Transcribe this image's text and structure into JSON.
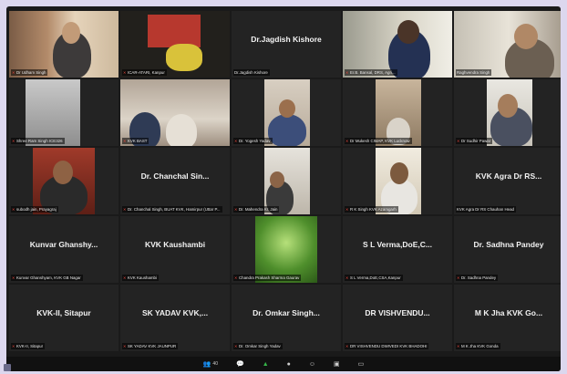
{
  "meeting": {
    "tiles": [
      {
        "caption": "Dr Udham Singh",
        "active": true,
        "video": true
      },
      {
        "caption": "ICAR-ATARI, Kanpur",
        "video": true
      },
      {
        "big": "Dr.Jagdish Kishore",
        "caption": "Dr.Jagdish Kishore"
      },
      {
        "caption": "Er.B. Bansal, DRS, Agri...",
        "video": true
      },
      {
        "caption": "Raghvendra Singh",
        "video": true
      },
      {
        "caption": "Shree Ram Singh ICE326",
        "video": true
      },
      {
        "caption": "KVK BAST",
        "video": true
      },
      {
        "caption": "Dr. Yogesh Yadav",
        "video": true
      },
      {
        "caption": "Dr Mukesh CIMAP, KVK Lucknow",
        "video": true
      },
      {
        "caption": "Dr Sudhir Pawar",
        "video": true
      },
      {
        "caption": "subodh jain, Prayagraj",
        "video": true
      },
      {
        "big": "Dr. Chanchal Sin...",
        "caption": "Dr. Chanchal Singh, BUAT KVK, Hamirpur (Uttar P..."
      },
      {
        "caption": "Dr. Mahendra Kr. Jain",
        "video": true
      },
      {
        "caption": "R K Singh KVK Azamgarh",
        "video": true
      },
      {
        "big": "KVK Agra Dr RS...",
        "caption": "KVK Agra Dr RS Chauhan Head"
      },
      {
        "big": "Kunvar Ghanshy...",
        "caption": "Kunvar Ghanshyam, KVK GB Nagar"
      },
      {
        "big": "KVK Kaushambi",
        "caption": "KVK Kaushambi"
      },
      {
        "caption": "Chandra Prakash Sharma Gaurav",
        "video": true
      },
      {
        "big": "S L Verma,DoE,C...",
        "caption": "S L Verma,DoE,CSA,Kanpur"
      },
      {
        "big": "Dr. Sadhna Pandey",
        "caption": "Dr. Sadhna Pandey"
      },
      {
        "big": "KVK-II, Sitapur",
        "caption": "KVK-II, Sitapur"
      },
      {
        "big": "SK YADAV KVK,...",
        "caption": "SK YADAV KVK JAUNPUR"
      },
      {
        "big": "Dr. Omkar Singh...",
        "caption": "Dr. Omkar Singh Yadav"
      },
      {
        "big": "DR VISHVENDU...",
        "caption": "DR VISHVENDU DWIVEDI KVK BHADOHI"
      },
      {
        "big": "M K Jha KVK Go...",
        "caption": "M K Jha KVK Gonda"
      }
    ]
  },
  "toolbar": {
    "participants_icon": "participants-icon",
    "participants_count": "40",
    "chat_icon": "chat-icon",
    "share_icon": "share-screen-icon",
    "record_icon": "record-icon",
    "reactions_icon": "reactions-icon",
    "apps_icon": "apps-icon",
    "whiteboard_icon": "whiteboard-icon",
    "colors": {
      "share": "#35b549",
      "alert": "#e64747"
    }
  }
}
